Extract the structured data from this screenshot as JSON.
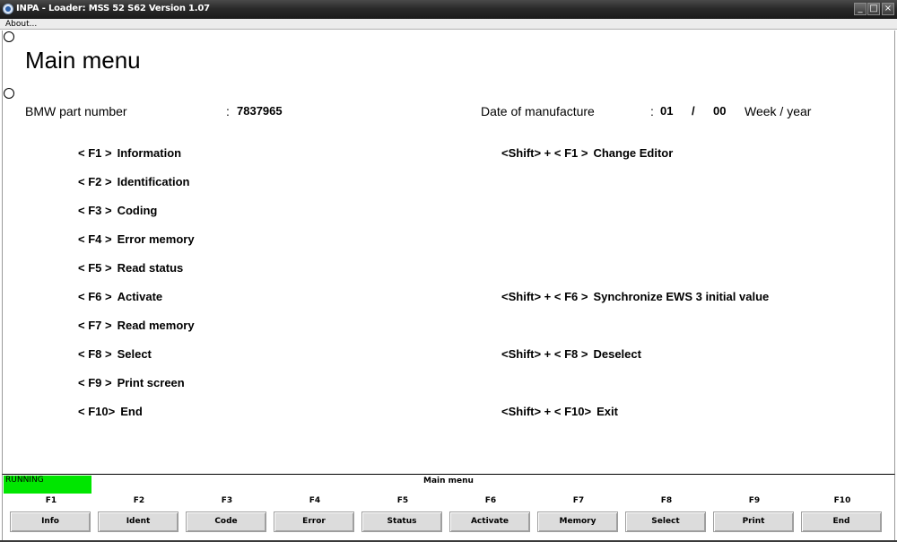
{
  "window": {
    "title": "INPA - Loader: MSS 52 S62 Version 1.07",
    "minimize": "_",
    "maximize": "□",
    "close": "×"
  },
  "menu": {
    "about": "About..."
  },
  "main": {
    "title": "Main menu",
    "part_label": "BMW part number",
    "part_sep": ":",
    "part_value": "7837965",
    "date_label": "Date of manufacture",
    "date_sep": ":",
    "date_week": "01",
    "date_slash": "/",
    "date_year": "00",
    "date_unit": "Week / year"
  },
  "left_functions": [
    {
      "key": "< F1 >",
      "label": "Information"
    },
    {
      "key": "< F2 >",
      "label": "Identification"
    },
    {
      "key": "< F3 >",
      "label": "Coding"
    },
    {
      "key": "< F4 >",
      "label": "Error memory"
    },
    {
      "key": "< F5 >",
      "label": "Read status"
    },
    {
      "key": "< F6 >",
      "label": "Activate"
    },
    {
      "key": "< F7 >",
      "label": "Read memory"
    },
    {
      "key": "< F8 >",
      "label": "Select"
    },
    {
      "key": "< F9 >",
      "label": "Print screen"
    },
    {
      "key": "< F10>",
      "label": "End"
    }
  ],
  "right_functions": [
    {
      "key": "<Shift> + < F1 >",
      "label": "Change Editor"
    },
    {
      "key": "<Shift> + < F6 >",
      "label": "Synchronize EWS 3 initial value"
    },
    {
      "key": "<Shift> + < F8 >",
      "label": "Deselect"
    },
    {
      "key": "<Shift> + < F10>",
      "label": "Exit"
    }
  ],
  "status": {
    "state": "RUNNING",
    "state_color": "#00e600",
    "screen": "Main menu"
  },
  "fkeys": [
    {
      "name": "F1",
      "label": "Info"
    },
    {
      "name": "F2",
      "label": "Ident"
    },
    {
      "name": "F3",
      "label": "Code"
    },
    {
      "name": "F4",
      "label": "Error"
    },
    {
      "name": "F5",
      "label": "Status"
    },
    {
      "name": "F6",
      "label": "Activate"
    },
    {
      "name": "F7",
      "label": "Memory"
    },
    {
      "name": "F8",
      "label": "Select"
    },
    {
      "name": "F9",
      "label": "Print"
    },
    {
      "name": "F10",
      "label": "End"
    }
  ]
}
